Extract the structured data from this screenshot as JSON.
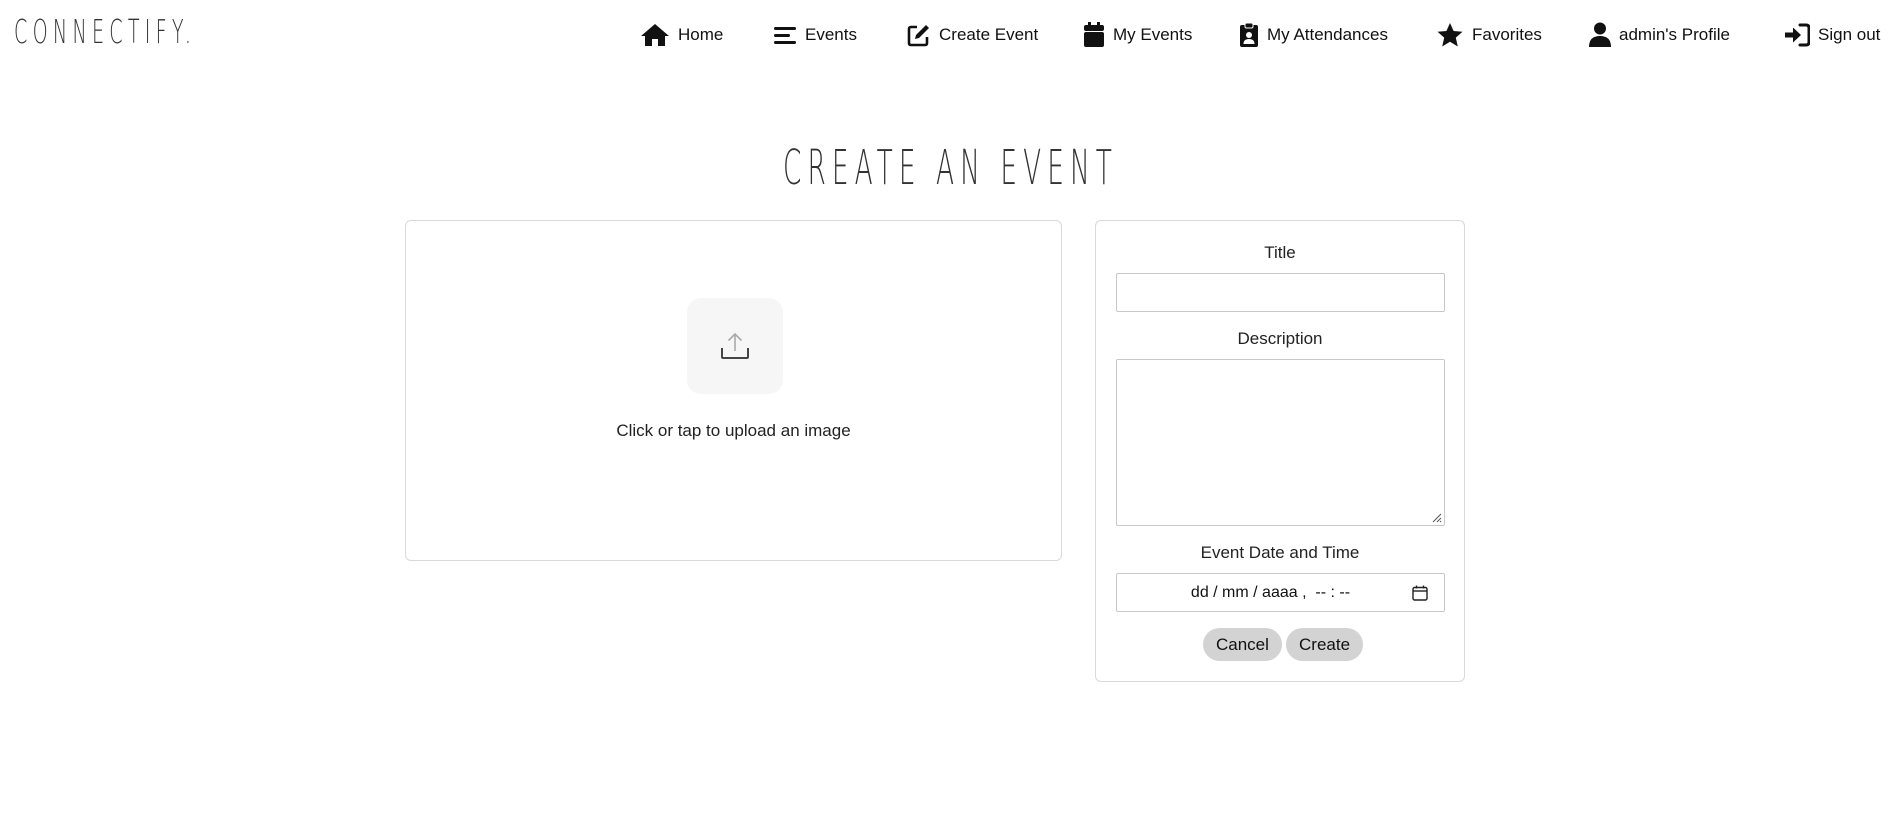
{
  "brand": "CONNECTIFY.",
  "nav": {
    "home": "Home",
    "events": "Events",
    "create_event": "Create Event",
    "my_events": "My Events",
    "my_attendances": "My Attendances",
    "favorites": "Favorites",
    "profile": "admin's Profile",
    "sign_out": "Sign out"
  },
  "page_title": "CREATE AN EVENT",
  "upload": {
    "text": "Click or tap to upload an image",
    "icon": "upload-icon"
  },
  "form": {
    "title_label": "Title",
    "title_value": "",
    "description_label": "Description",
    "description_value": "",
    "datetime_label": "Event Date and Time",
    "datetime_placeholder": "dd / mm / aaaa ,  -- : --",
    "cancel_label": "Cancel",
    "create_label": "Create"
  },
  "icons": [
    "home-icon",
    "events-icon",
    "edit-icon",
    "calendar-icon",
    "clipboard-user-icon",
    "star-icon",
    "user-icon",
    "sign-in-icon",
    "upload-icon",
    "calendar-icon"
  ]
}
